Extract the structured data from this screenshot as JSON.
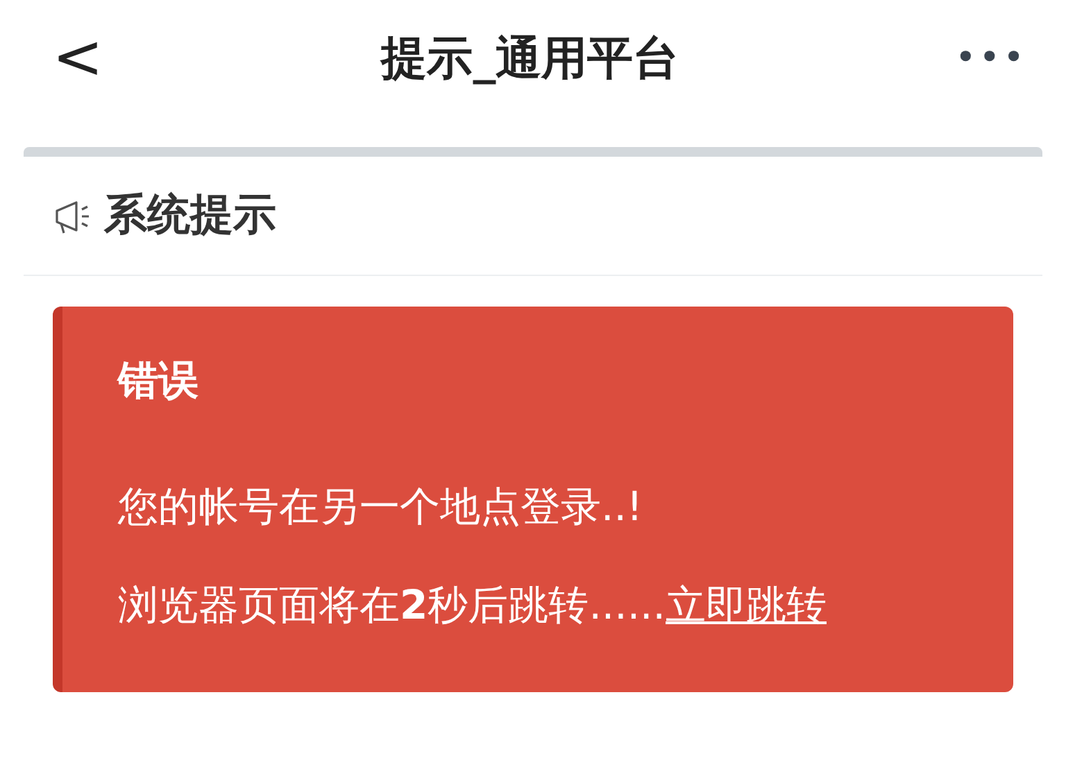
{
  "nav_bar": {
    "back": "<",
    "title": "提示_通用平台",
    "more": "•••"
  },
  "section": {
    "title": "系统提示"
  },
  "alert": {
    "heading": "错误",
    "message": "您的帐号在另一个地点登录..!",
    "redirect_text": "浏览器页面将在**2**秒后跳转......",
    "redirect_link": "立即跳转"
  }
}
